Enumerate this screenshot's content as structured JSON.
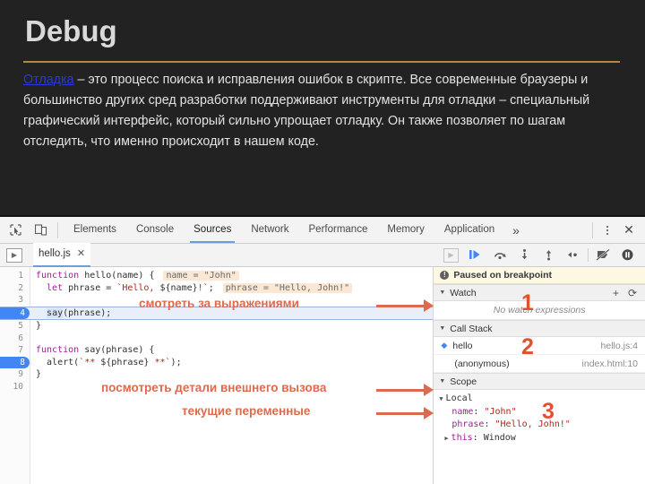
{
  "slide": {
    "title": "Debug",
    "link_text": "Отладка",
    "body_text": " – это процесс поиска и исправления ошибок в скрипте. Все современные браузеры и большинство других сред разработки поддерживают инструменты для отладки – специальный графический интерфейс, который сильно упрощает отладку. Он также позволяет по шагам отследить, что именно происходит в нашем коде.",
    "rule_color": "#b5863b",
    "link_color": "#2f37d8",
    "background": "#222222"
  },
  "devtools": {
    "toolbar": {
      "inspect_icon": "inspect-cursor-icon",
      "device_icon": "device-toolbar-icon",
      "tabs": [
        {
          "label": "Elements",
          "active": false
        },
        {
          "label": "Console",
          "active": false
        },
        {
          "label": "Sources",
          "active": true
        },
        {
          "label": "Network",
          "active": false
        },
        {
          "label": "Performance",
          "active": false
        },
        {
          "label": "Memory",
          "active": false
        },
        {
          "label": "Application",
          "active": false
        }
      ],
      "more_label": "»",
      "kebab_icon": "more-options-icon",
      "close_label": "✕",
      "active_tab_underline": "#6f9ddb"
    },
    "subbar": {
      "navigator_toggle_icon": "show-navigator-icon",
      "file_tab": {
        "name": "hello.js",
        "close_label": "✕"
      },
      "sidebar_toggle_icon": "show-debugger-icon",
      "debugger_buttons": [
        {
          "name": "resume-script-execution",
          "glyph": "resume"
        },
        {
          "name": "step-over-next-function-call",
          "glyph": "step-over"
        },
        {
          "name": "step-into-next-function-call",
          "glyph": "step-into"
        },
        {
          "name": "step-out-of-current-function",
          "glyph": "step-out"
        },
        {
          "name": "step",
          "glyph": "step"
        },
        {
          "name": "deactivate-breakpoints",
          "glyph": "deactivate-breakpoints"
        },
        {
          "name": "pause-on-exceptions",
          "glyph": "pause-on-exceptions"
        }
      ]
    },
    "code": {
      "lines": [
        {
          "num": "1",
          "breakpoint": false,
          "current": false,
          "tokens": [
            {
              "t": "function ",
              "c": "kw"
            },
            {
              "t": "hello",
              "c": "fn"
            },
            {
              "t": "(name) {",
              "c": "plain"
            }
          ],
          "inline_value": "name = \"John\""
        },
        {
          "num": "2",
          "breakpoint": false,
          "current": false,
          "tokens": [
            {
              "t": "  let ",
              "c": "kw"
            },
            {
              "t": "phrase = ",
              "c": "plain"
            },
            {
              "t": "`Hello, ",
              "c": "str"
            },
            {
              "t": "${name}",
              "c": "interp"
            },
            {
              "t": "!`",
              "c": "str"
            },
            {
              "t": ";",
              "c": "plain"
            }
          ],
          "inline_value": "phrase = \"Hello, John!\""
        },
        {
          "num": "3",
          "breakpoint": false,
          "current": false,
          "tokens": [],
          "inline_value": ""
        },
        {
          "num": "4",
          "breakpoint": true,
          "current": true,
          "tokens": [
            {
              "t": "  ",
              "c": "plain"
            },
            {
              "t": "say",
              "c": "sel-word"
            },
            {
              "t": "(phrase);",
              "c": "plain"
            }
          ],
          "inline_value": ""
        },
        {
          "num": "5",
          "breakpoint": false,
          "current": false,
          "tokens": [
            {
              "t": "}",
              "c": "plain"
            }
          ],
          "inline_value": ""
        },
        {
          "num": "6",
          "breakpoint": false,
          "current": false,
          "tokens": [],
          "inline_value": ""
        },
        {
          "num": "7",
          "breakpoint": false,
          "current": false,
          "tokens": [
            {
              "t": "function ",
              "c": "kw"
            },
            {
              "t": "say",
              "c": "fn"
            },
            {
              "t": "(phrase) {",
              "c": "plain"
            }
          ],
          "inline_value": ""
        },
        {
          "num": "8",
          "breakpoint": true,
          "current": false,
          "tokens": [
            {
              "t": "  alert(",
              "c": "plain"
            },
            {
              "t": "`** ",
              "c": "str"
            },
            {
              "t": "${phrase}",
              "c": "interp"
            },
            {
              "t": " **`",
              "c": "str"
            },
            {
              "t": ");",
              "c": "plain"
            }
          ],
          "inline_value": ""
        },
        {
          "num": "9",
          "breakpoint": false,
          "current": false,
          "tokens": [
            {
              "t": "}",
              "c": "plain"
            }
          ],
          "inline_value": ""
        },
        {
          "num": "10",
          "breakpoint": false,
          "current": false,
          "tokens": [],
          "inline_value": ""
        }
      ]
    },
    "sidebar": {
      "paused_message": "Paused on breakpoint",
      "watch": {
        "title": "Watch",
        "add_label": "+",
        "refresh_label": "⟳",
        "empty_message": "No watch expressions"
      },
      "call_stack": {
        "title": "Call Stack",
        "frames": [
          {
            "name": "hello",
            "location": "hello.js:4",
            "active": true
          },
          {
            "name": "(anonymous)",
            "location": "index.html:10",
            "active": false
          }
        ]
      },
      "scope": {
        "title": "Scope",
        "group": "Local",
        "variables": [
          {
            "key": "name",
            "value": "\"John\"",
            "expandable": false
          },
          {
            "key": "phrase",
            "value": "\"Hello, John!\"",
            "expandable": false
          },
          {
            "key": "this",
            "value": "Window",
            "expandable": true
          }
        ]
      }
    }
  },
  "annotations": {
    "color": "#dd6a4c",
    "number_color": "#e0522f",
    "callouts": [
      {
        "text": "смотреть за выражениями",
        "number": "1"
      },
      {
        "text": "посмотреть детали внешнего вызова",
        "number": "2"
      },
      {
        "text": "текущие переменные",
        "number": "3"
      }
    ],
    "numbers": [
      "1",
      "2",
      "3"
    ]
  }
}
